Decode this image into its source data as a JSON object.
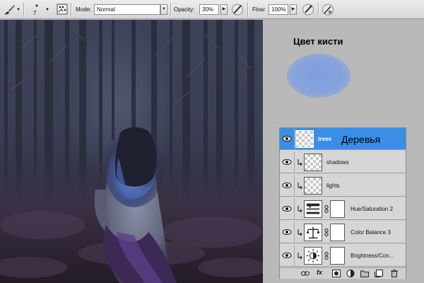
{
  "options_bar": {
    "brush_size": "7",
    "mode_label": "Mode:",
    "mode_value": "Normal",
    "opacity_label": "Opacity:",
    "opacity_value": "30%",
    "flow_label": "Flow:",
    "flow_value": "100%"
  },
  "annotations": {
    "brush_color_label": "Цвет кисти",
    "trees_translation": "Деревья",
    "brush_color_hex": "#86a3dc"
  },
  "layers": {
    "items": [
      {
        "name": "trees",
        "selected": true,
        "kind": "pixel"
      },
      {
        "name": "shadows",
        "selected": false,
        "kind": "pixel"
      },
      {
        "name": "lights",
        "selected": false,
        "kind": "pixel"
      },
      {
        "name": "Hue/Saturation 2",
        "selected": false,
        "kind": "adjustment"
      },
      {
        "name": "Color Balance 3",
        "selected": false,
        "kind": "adjustment"
      },
      {
        "name": "Brightness/Con...",
        "selected": false,
        "kind": "adjustment"
      }
    ],
    "footer_fx": "fx"
  },
  "colors": {
    "selection": "#3a8ee6",
    "panel_bg": "#b9b9b9"
  }
}
